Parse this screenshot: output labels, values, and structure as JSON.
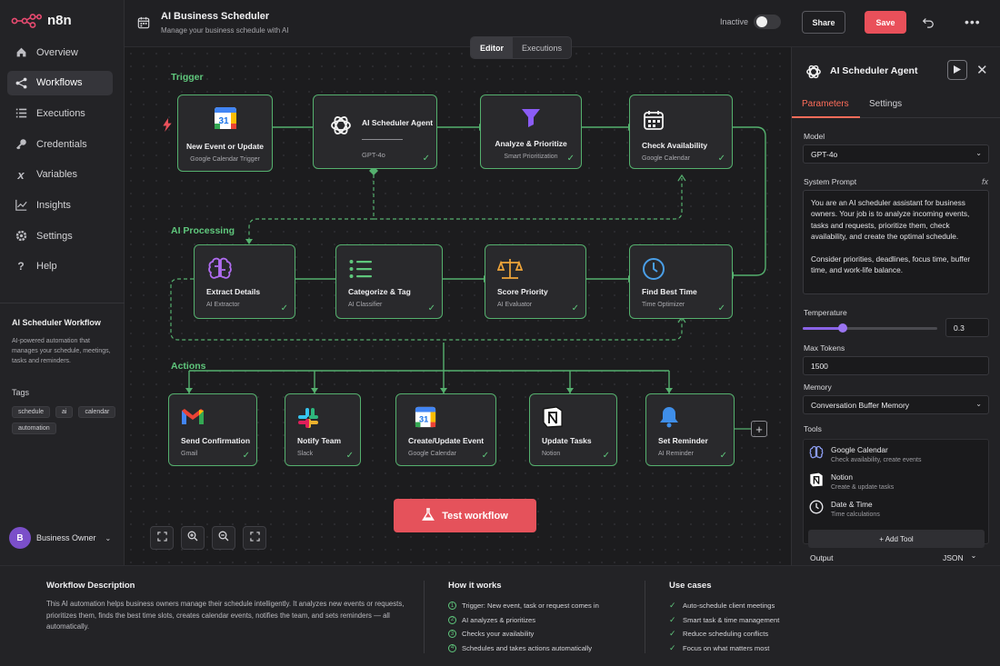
{
  "app": {
    "logo_text": "n8n"
  },
  "sidebar": {
    "items": [
      {
        "label": "Overview",
        "icon": "house-icon"
      },
      {
        "label": "Workflows",
        "icon": "share-nodes-icon",
        "active": true
      },
      {
        "label": "Executions",
        "icon": "list-icon"
      },
      {
        "label": "Credentials",
        "icon": "key-icon"
      },
      {
        "label": "Variables",
        "icon": "variable-x-icon"
      },
      {
        "label": "Insights",
        "icon": "chart-line-icon"
      },
      {
        "label": "Settings",
        "icon": "gear-icon"
      },
      {
        "label": "Help",
        "icon": "question-icon"
      }
    ],
    "workflow_title": "AI Scheduler Workflow",
    "workflow_desc": "AI-powered automation that manages your schedule, meetings, tasks and reminders.",
    "tags_label": "Tags",
    "tags": [
      "schedule",
      "ai",
      "calendar",
      "automation"
    ],
    "user": {
      "initial": "B",
      "name": "Business Owner"
    }
  },
  "header": {
    "title": "AI Business Scheduler",
    "subtitle": "Manage your business schedule with AI",
    "status_label": "Inactive",
    "share_label": "Share",
    "save_label": "Save",
    "view_tabs": [
      "Editor",
      "Executions"
    ]
  },
  "canvas": {
    "sections": {
      "trigger": "Trigger",
      "processing": "AI Processing",
      "actions": "Actions"
    },
    "nodes": {
      "n1": {
        "title": "New Event or Update",
        "sub": "Google Calendar Trigger"
      },
      "n2": {
        "title": "AI Scheduler Agent",
        "sub": "GPT-4o"
      },
      "n3": {
        "title": "Analyze & Prioritize",
        "sub": "Smart Prioritization"
      },
      "n4": {
        "title": "Check Availability",
        "sub": "Google Calendar"
      },
      "p1": {
        "title": "Extract Details",
        "sub": "AI Extractor"
      },
      "p2": {
        "title": "Categorize & Tag",
        "sub": "AI Classifier"
      },
      "p3": {
        "title": "Score Priority",
        "sub": "AI Evaluator"
      },
      "p4": {
        "title": "Find Best Time",
        "sub": "Time Optimizer"
      },
      "a1": {
        "title": "Send Confirmation",
        "sub": "Gmail"
      },
      "a2": {
        "title": "Notify Team",
        "sub": "Slack"
      },
      "a3": {
        "title": "Create/Update Event",
        "sub": "Google Calendar"
      },
      "a4": {
        "title": "Update Tasks",
        "sub": "Notion"
      },
      "a5": {
        "title": "Set Reminder",
        "sub": "AI Reminder"
      }
    },
    "test_button": "Test workflow",
    "colors": {
      "accent_green": "#5fc77c",
      "primary_red": "#e5525b",
      "accent_orange": "#ff6d5a"
    }
  },
  "panel": {
    "title": "AI Scheduler Agent",
    "tabs": [
      "Parameters",
      "Settings"
    ],
    "model_label": "Model",
    "model_value": "GPT-4o",
    "system_prompt_label": "System Prompt",
    "fx_label": "fx",
    "system_prompt": "You are an AI scheduler assistant for business owners. Your job is to analyze incoming events, tasks and requests, prioritize them, check availability, and create the optimal schedule.\n\nConsider priorities, deadlines, focus time, buffer time, and work-life balance.",
    "temperature_label": "Temperature",
    "temperature_value": "0.3",
    "temperature_fraction": 0.3,
    "max_tokens_label": "Max Tokens",
    "max_tokens_value": "1500",
    "memory_label": "Memory",
    "memory_value": "Conversation Buffer Memory",
    "tools_label": "Tools",
    "tools": [
      {
        "name": "Google Calendar",
        "desc": "Check availability, create events"
      },
      {
        "name": "Notion",
        "desc": "Create & update tasks"
      },
      {
        "name": "Date & Time",
        "desc": "Time calculations"
      }
    ],
    "add_tool_label": "+ Add Tool",
    "output_label": "Output",
    "output_value": "JSON"
  },
  "footer": {
    "desc_title": "Workflow Description",
    "desc_text": "This AI automation helps business owners manage their schedule intelligently. It analyzes new events or requests, prioritizes them, finds the best time slots, creates calendar events, notifies the team, and sets reminders — all automatically.",
    "how_title": "How it works",
    "how_steps": [
      {
        "num": "1",
        "text": "Trigger: New event, task or request comes in"
      },
      {
        "num": "2",
        "text": "AI analyzes & prioritizes"
      },
      {
        "num": "3",
        "text": "Checks your availability"
      },
      {
        "num": "4",
        "text": "Schedules and takes actions automatically"
      }
    ],
    "use_title": "Use cases",
    "use_cases": [
      "Auto-schedule client meetings",
      "Smart task & time management",
      "Reduce scheduling conflicts",
      "Focus on what matters most"
    ]
  }
}
